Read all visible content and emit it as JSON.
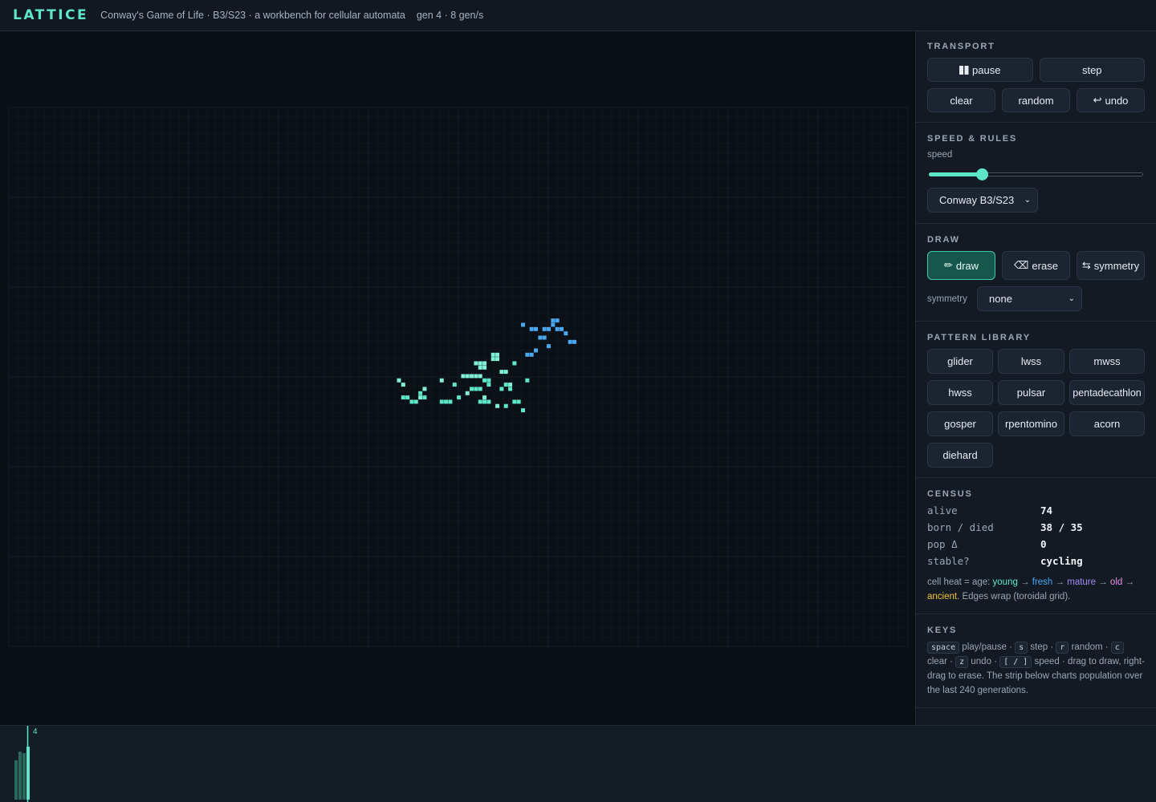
{
  "header": {
    "logo": "LATTICE",
    "subtitle": "Conway's Game of Life · B3/S23 · a workbench for cellular automata",
    "gen_rate": "gen 4 · 8 gen/s"
  },
  "panel": {
    "transport": {
      "title": "TRANSPORT",
      "pause": "pause",
      "step": "step",
      "clear": "clear",
      "random": "random",
      "undo": "undo"
    },
    "speed_rules": {
      "title": "SPEED & RULES",
      "speed_label": "speed",
      "speed_fraction": 0.25,
      "rule_selected": "Conway B3/S23"
    },
    "draw": {
      "title": "DRAW",
      "draw": "draw",
      "erase": "erase",
      "symmetry": "symmetry",
      "symmetry_label": "symmetry",
      "symmetry_selected": "none"
    },
    "patterns": {
      "title": "PATTERN LIBRARY",
      "items": [
        "glider",
        "lwss",
        "mwss",
        "hwss",
        "pulsar",
        "pentadecathlon",
        "gosper",
        "rpentomino",
        "acorn",
        "diehard"
      ]
    },
    "census": {
      "title": "CENSUS",
      "alive_label": "alive",
      "alive": "74",
      "born_died_label": "born / died",
      "born_died": "38 / 35",
      "pop_delta_label": "pop Δ",
      "pop_delta": "0",
      "stable_label": "stable?",
      "stable": "cycling",
      "heat_prefix": "cell heat = age: ",
      "heat_young": "young",
      "heat_fresh": "fresh",
      "heat_mature": "mature",
      "heat_old": "old",
      "heat_ancient": "ancient",
      "heat_suffix": ". Edges wrap (toroidal grid).",
      "arrow": " → "
    },
    "keys": {
      "title": "KEYS",
      "k_space": "space",
      "t_space": " play/pause · ",
      "k_s": "s",
      "t_s": " step · ",
      "k_r": "r",
      "t_r": " random · ",
      "k_c": "c",
      "t_c": " clear · ",
      "k_z": "z",
      "t_z": " undo · ",
      "k_speed": "[ / ]",
      "t_speed": " speed · drag to draw, right-drag to erase. The strip below charts population over the last 240 generations."
    }
  },
  "strip": {
    "current_gen": "4",
    "history": [
      55,
      67,
      65,
      74
    ]
  },
  "colors": {
    "young": "#5ee6c8",
    "fresh": "#4aa8f0",
    "mature": "#a58cf5",
    "old": "#e894e0",
    "ancient": "#f2c532",
    "accent": "#5ee6c8"
  },
  "cells": [
    [
      [
        39,
        12
      ],
      [
        32,
        16
      ],
      [
        33,
        16
      ],
      [
        42,
        16
      ],
      [
        25,
        17
      ],
      [
        33,
        17
      ],
      [
        37,
        17
      ],
      [
        29,
        18
      ],
      [
        30,
        18
      ],
      [
        31,
        18
      ],
      [
        36,
        18
      ],
      [
        38,
        18
      ],
      [
        17,
        19
      ],
      [
        13,
        20
      ],
      [
        14,
        20
      ],
      [
        18,
        20
      ],
      [
        26,
        20
      ],
      [
        15,
        21
      ],
      [
        16,
        21
      ],
      [
        22,
        21
      ],
      [
        23,
        21
      ],
      [
        24,
        21
      ],
      [
        31,
        21
      ],
      [
        32,
        21
      ],
      [
        33,
        21
      ],
      [
        39,
        21
      ],
      [
        40,
        21
      ],
      [
        37,
        22
      ],
      [
        41,
        23
      ]
    ],
    [
      [
        34,
        10
      ],
      [
        35,
        10
      ],
      [
        34,
        11
      ],
      [
        35,
        11
      ],
      [
        30,
        12
      ],
      [
        31,
        12
      ],
      [
        32,
        12
      ],
      [
        31,
        13
      ],
      [
        32,
        13
      ],
      [
        36,
        14
      ],
      [
        37,
        14
      ],
      [
        27,
        15
      ],
      [
        28,
        15
      ],
      [
        29,
        15
      ],
      [
        30,
        15
      ],
      [
        31,
        15
      ],
      [
        12,
        16
      ],
      [
        22,
        16
      ],
      [
        13,
        17
      ],
      [
        38,
        17
      ],
      [
        18,
        18
      ],
      [
        28,
        19
      ],
      [
        17,
        20
      ],
      [
        32,
        20
      ],
      [
        35,
        22
      ]
    ],
    [
      [
        48,
        2
      ],
      [
        49,
        2
      ],
      [
        41,
        3
      ],
      [
        48,
        3
      ],
      [
        43,
        4
      ],
      [
        44,
        4
      ],
      [
        46,
        4
      ],
      [
        47,
        4
      ],
      [
        49,
        4
      ],
      [
        50,
        4
      ],
      [
        51,
        5
      ],
      [
        45,
        6
      ],
      [
        46,
        6
      ],
      [
        52,
        7
      ],
      [
        53,
        7
      ],
      [
        47,
        8
      ],
      [
        44,
        9
      ],
      [
        42,
        10
      ],
      [
        43,
        10
      ]
    ]
  ]
}
